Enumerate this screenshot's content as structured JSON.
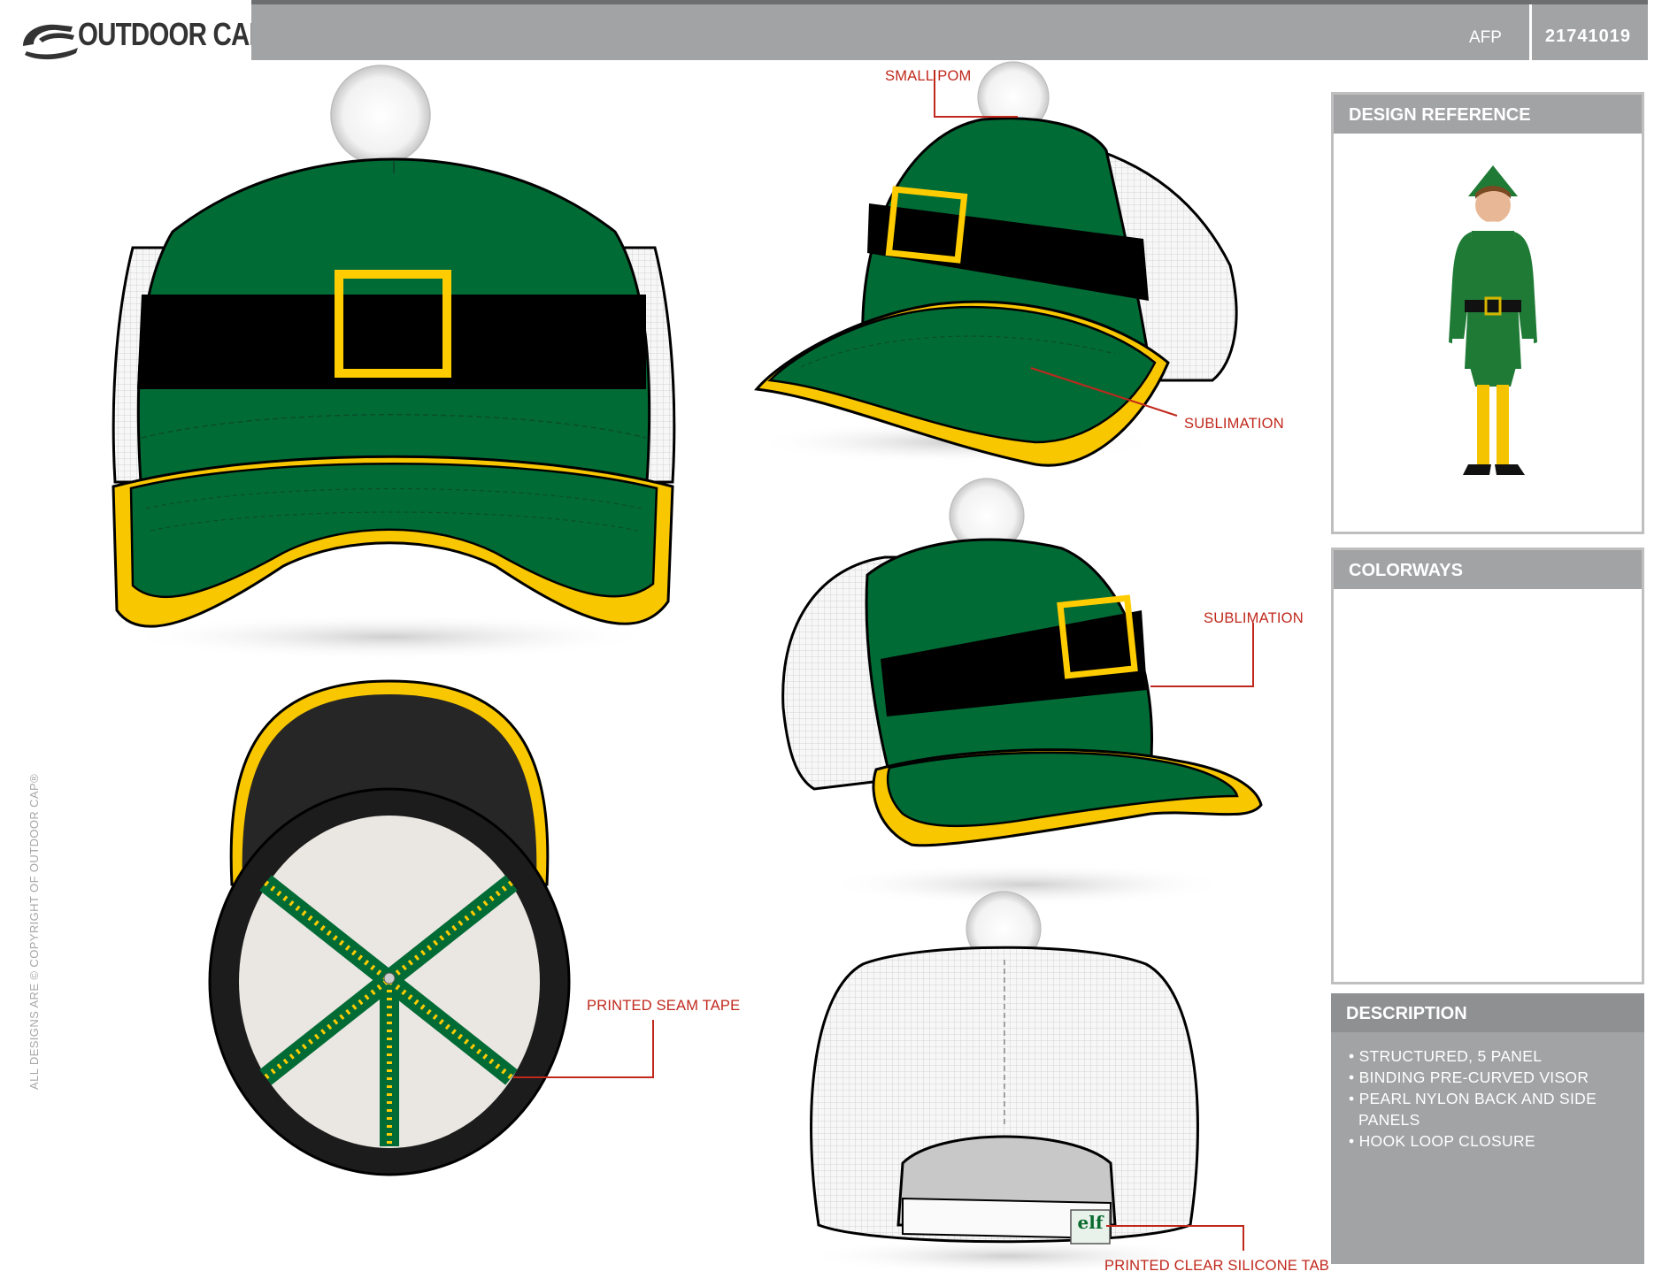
{
  "header": {
    "brand": "OUTDOOR CAP",
    "season": "AFP",
    "style_code": "21741019"
  },
  "panels": {
    "design_reference": {
      "title": "DESIGN REFERENCE"
    },
    "colorways": {
      "title": "COLORWAYS"
    },
    "description": {
      "title": "DESCRIPTION",
      "items": [
        "• STRUCTURED, 5 PANEL",
        "• BINDING PRE-CURVED VISOR",
        "• PEARL NYLON BACK AND SIDE",
        "PANELS",
        "• HOOK LOOP CLOSURE"
      ]
    }
  },
  "callouts": {
    "small_pom": "SMALL POM",
    "sublimation_top": "SUBLIMATION",
    "sublimation_side": "SUBLIMATION",
    "seam_tape": "PRINTED SEAM TAPE",
    "silicone_tab": "PRINTED CLEAR SILICONE TAB"
  },
  "tab_text": "elf",
  "copyright": "ALL DESIGNS ARE © COPYRIGHT OF OUTDOOR CAP®",
  "colors": {
    "crown_green": "#016b35",
    "belt_black": "#000000",
    "buckle_gold": "#ffcc00",
    "visor_binding": "#f9c700",
    "mesh_white": "#f4f4f4",
    "callout_red": "#c0281c",
    "header_gray": "#a2a3a5"
  }
}
